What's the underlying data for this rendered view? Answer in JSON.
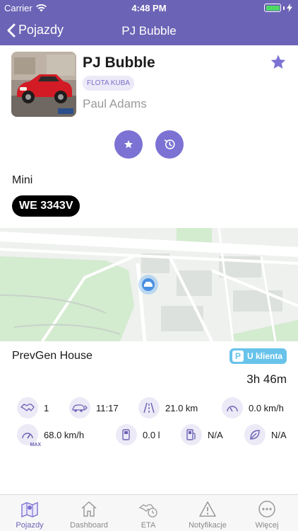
{
  "status_bar": {
    "carrier": "Carrier",
    "time": "4:48 PM"
  },
  "nav": {
    "back_label": "Pojazdy",
    "title": "PJ Bubble"
  },
  "vehicle": {
    "name": "PJ Bubble",
    "fleet": "FLOTA KUBA",
    "driver": "Paul Adams",
    "make": "Mini",
    "plate": "WE 3343V",
    "favorite": true
  },
  "location": {
    "place": "PrevGen House",
    "status_label": "U klienta",
    "status_icon_letter": "P",
    "duration": "3h 46m"
  },
  "stats": {
    "handshake": "1",
    "time": "11:17",
    "distance": "21.0 km",
    "speed": "0.0 km/h",
    "max_tag": "MAX",
    "max_speed": "68.0 km/h",
    "fuel": "0.0 l",
    "fuel_station": "N/A",
    "eco": "N/A"
  },
  "tabs": [
    {
      "label": "Pojazdy",
      "icon": "map-icon",
      "active": true
    },
    {
      "label": "Dashboard",
      "icon": "home-icon",
      "active": false
    },
    {
      "label": "ETA",
      "icon": "eta-icon",
      "active": false
    },
    {
      "label": "Notyfikacje",
      "icon": "warning-icon",
      "active": false
    },
    {
      "label": "Więcej",
      "icon": "more-icon",
      "active": false
    }
  ],
  "colors": {
    "header": "#6b63b5",
    "accent": "#7b72d3",
    "status_pill": "#67c3ea"
  }
}
